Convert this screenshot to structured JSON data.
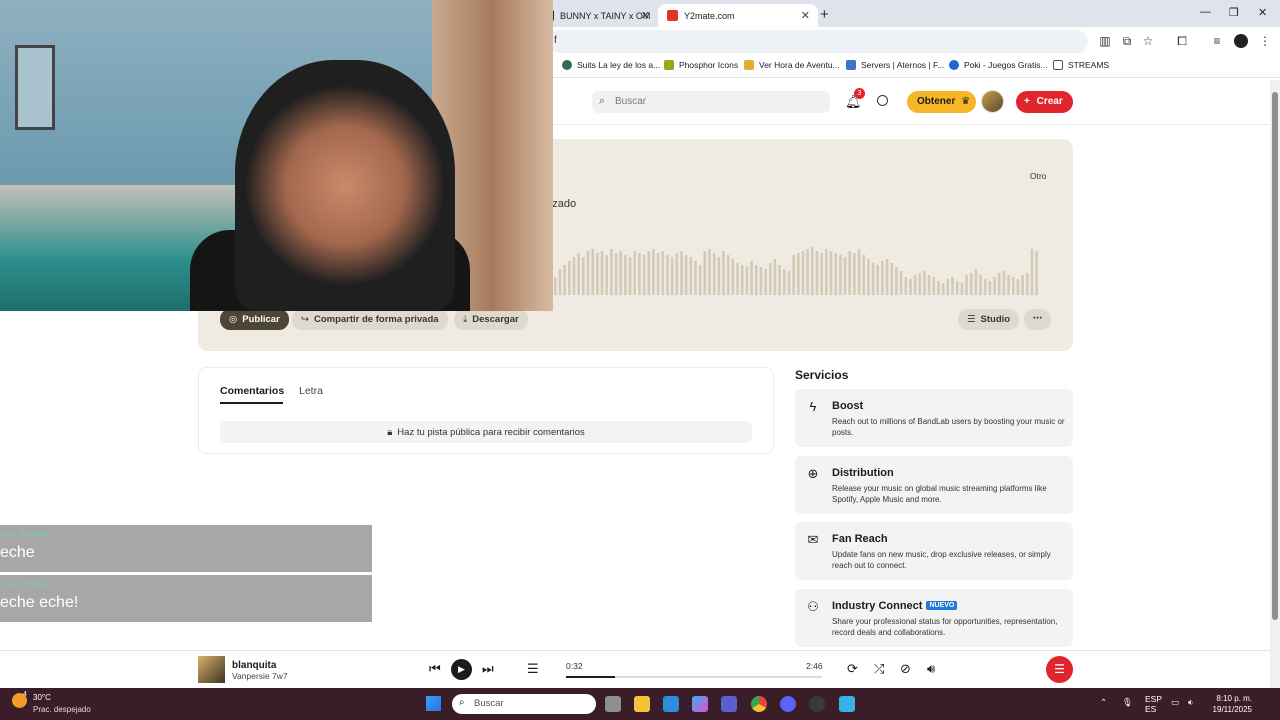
{
  "browser": {
    "tabs": [
      {
        "label": "BUNNY x TAINY x OM",
        "favicon_color": "#2b2b2b",
        "active": false
      },
      {
        "label": "Y2mate.com",
        "favicon_color": "#e0342a",
        "active": true
      }
    ],
    "url": "f",
    "bookmarks": [
      {
        "label": "Suits La ley de los a...",
        "color": "#2f6f4f"
      },
      {
        "label": "Phosphor Icons",
        "color": "#9aa51a"
      },
      {
        "label": "Ver Hora de Aventu...",
        "color": "#e2b12b"
      },
      {
        "label": "Servers | Aternos | F...",
        "color": "#3d73c9"
      },
      {
        "label": "Poki - Juegos Gratis...",
        "color": "#1d67d8"
      },
      {
        "label": "STREAMS",
        "color": "#555555"
      }
    ]
  },
  "header": {
    "search_placeholder": "Buscar",
    "notifications_count": "3",
    "obtener_label": "Obtener",
    "crear_label": "Crear"
  },
  "track": {
    "otro_label": "Otro",
    "subtitle": "erizado",
    "actions": {
      "publicar": "Publicar",
      "compartir": "Compartir de forma privada",
      "descargar": "Descargar",
      "studio": "Studio",
      "more": "⋯"
    }
  },
  "comments": {
    "tabs": [
      "Comentarios",
      "Letra"
    ],
    "notice": "Haz tu pista pública para recibir comentarios"
  },
  "services": {
    "title": "Servicios",
    "items": [
      {
        "title": "Boost",
        "desc": "Reach out to millions of BandLab users by boosting your music or posts.",
        "icon": "bolt-icon"
      },
      {
        "title": "Distribution",
        "desc": "Release your music on global music streaming platforms like Spotify, Apple Music and more.",
        "icon": "globe-icon"
      },
      {
        "title": "Fan Reach",
        "desc": "Update fans on new music, drop exclusive releases, or simply reach out to connect.",
        "icon": "mail-icon"
      },
      {
        "title": "Industry Connect",
        "badge": "NUEVO",
        "desc": "Share your professional status for opportunities, representation, record deals and collaborations.",
        "icon": "people-icon"
      }
    ]
  },
  "chat": {
    "messages": [
      {
        "user": "LAX_ROCCO",
        "text": "eche"
      },
      {
        "user": "LAX_ROCCO",
        "text": "eche eche!"
      }
    ]
  },
  "player": {
    "title": "blanquita",
    "artist": "Vanpersie 7w7",
    "current_time": "0:32",
    "total_time": "2:46",
    "progress": 0.19
  },
  "taskbar": {
    "weather_badge": "4",
    "temperature": "30°C",
    "weather_desc": "Prac. despejado",
    "search_placeholder": "Buscar",
    "language": "ESP",
    "region": "ES",
    "time": "8:10 p. m.",
    "date": "19/11/2025"
  },
  "waveform": [
    18,
    26,
    30,
    34,
    38,
    42,
    38,
    44,
    46,
    42,
    44,
    40,
    46,
    42,
    44,
    40,
    38,
    44,
    42,
    40,
    44,
    46,
    42,
    44,
    40,
    38,
    42,
    44,
    40,
    38,
    34,
    30,
    44,
    46,
    42,
    38,
    44,
    40,
    36,
    32,
    30,
    28,
    34,
    30,
    28,
    26,
    32,
    36,
    30,
    26,
    24,
    40,
    42,
    44,
    46,
    48,
    44,
    42,
    46,
    44,
    42,
    40,
    38,
    44,
    42,
    46,
    40,
    36,
    32,
    30,
    34,
    36,
    32,
    28,
    24,
    18,
    16,
    20,
    22,
    24,
    20,
    18,
    14,
    12,
    16,
    18,
    14,
    12,
    20,
    22,
    26,
    20,
    16,
    14,
    18,
    22,
    24,
    20,
    18,
    16,
    20,
    22,
    46,
    44
  ]
}
